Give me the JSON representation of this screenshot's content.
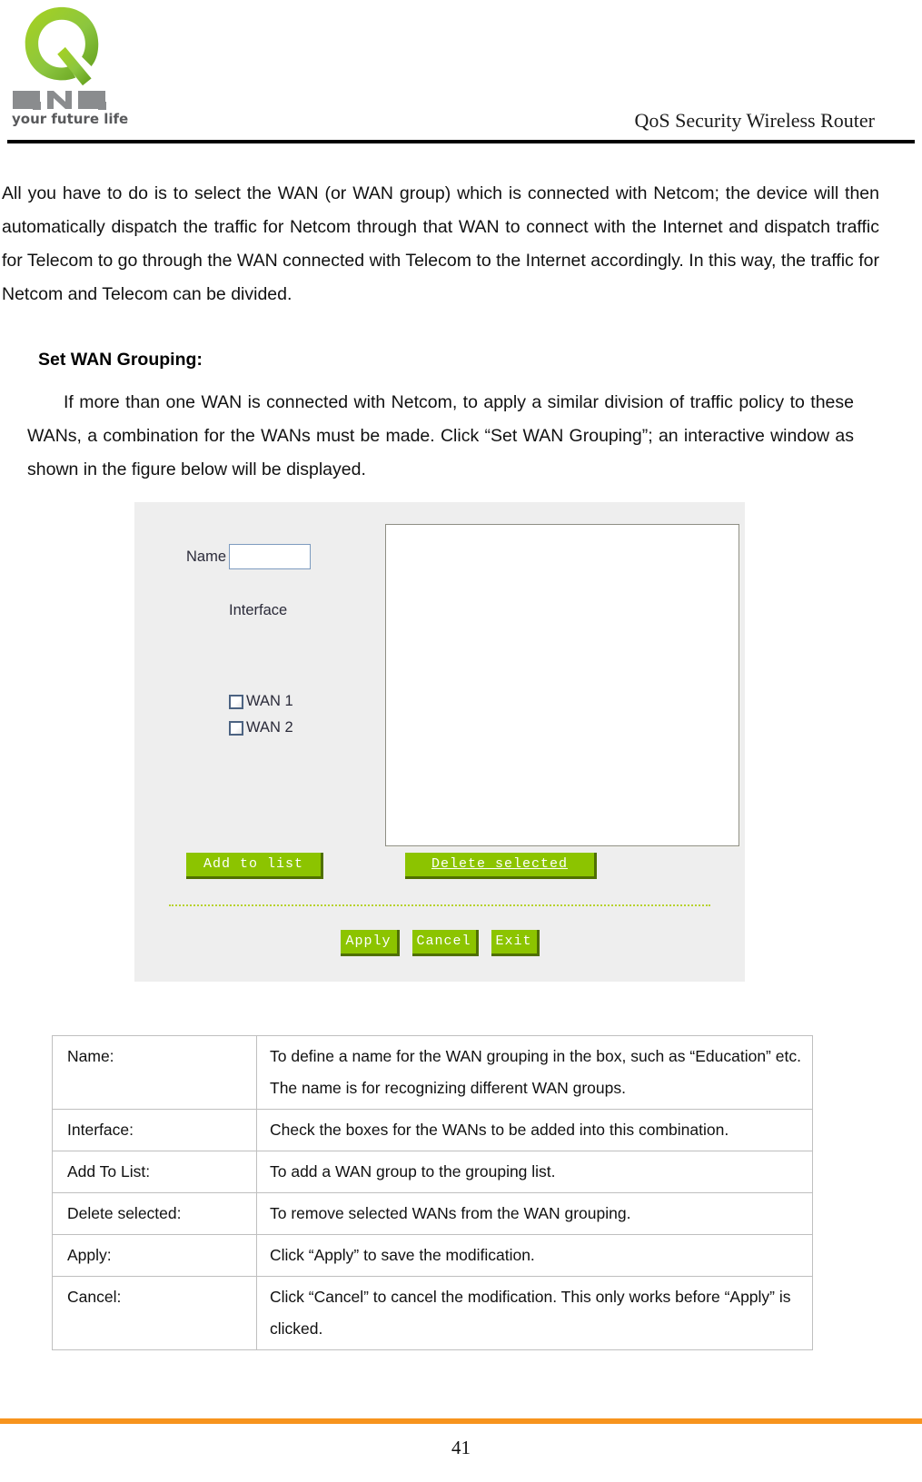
{
  "header": {
    "logo": {
      "mark_letter": "Q",
      "wordmark": "QNO",
      "tagline": "your future life"
    },
    "title": "QoS Security Wireless Router"
  },
  "body": {
    "paragraph_1": "All you have to do is to select the WAN (or WAN group) which is connected with Netcom; the device will then automatically dispatch the traffic for Netcom through that WAN to connect with the Internet and dispatch traffic for Telecom to go through the WAN connected with Telecom to the Internet accordingly. In this way, the traffic for Netcom and Telecom can be divided.",
    "section_heading": "Set WAN Grouping:",
    "paragraph_2": "If more than one WAN is connected with Netcom, to apply a similar division of traffic policy to these WANs, a combination for the WANs must be made. Click “Set WAN Grouping”; an interactive window as shown in the figure below will be displayed."
  },
  "dialog": {
    "name_label": "Name",
    "name_value": "",
    "name_placeholder": "",
    "interface_label": "Interface",
    "interfaces": [
      {
        "label": "WAN 1",
        "checked": false
      },
      {
        "label": "WAN 2",
        "checked": false
      }
    ],
    "buttons": {
      "add_to_list": "Add to list",
      "delete_selected": "Delete selected",
      "apply": "Apply",
      "cancel": "Cancel",
      "exit": "Exit"
    },
    "colors": {
      "button_green": "#8cc400",
      "button_shadow": "#4f7000",
      "panel_bg": "#eeeeee",
      "separator": "#b7d22c"
    }
  },
  "description_table": {
    "rows": [
      {
        "term": "Name:",
        "desc": "To define a name for the WAN grouping in the box, such as “Education” etc. The name is for recognizing different WAN groups."
      },
      {
        "term": "Interface:",
        "desc": "Check the boxes for the WANs to be added into this combination."
      },
      {
        "term": "Add To List:",
        "desc": "To add a WAN group to the grouping list."
      },
      {
        "term": "Delete selected:",
        "desc": "To remove selected WANs from the WAN grouping."
      },
      {
        "term": "Apply:",
        "desc": "Click “Apply” to save the modification."
      },
      {
        "term": "Cancel:",
        "desc": "Click “Cancel” to cancel the modification. This only works before “Apply” is clicked."
      }
    ]
  },
  "footer": {
    "page_number": "41",
    "rule_color": "#f7941d"
  }
}
